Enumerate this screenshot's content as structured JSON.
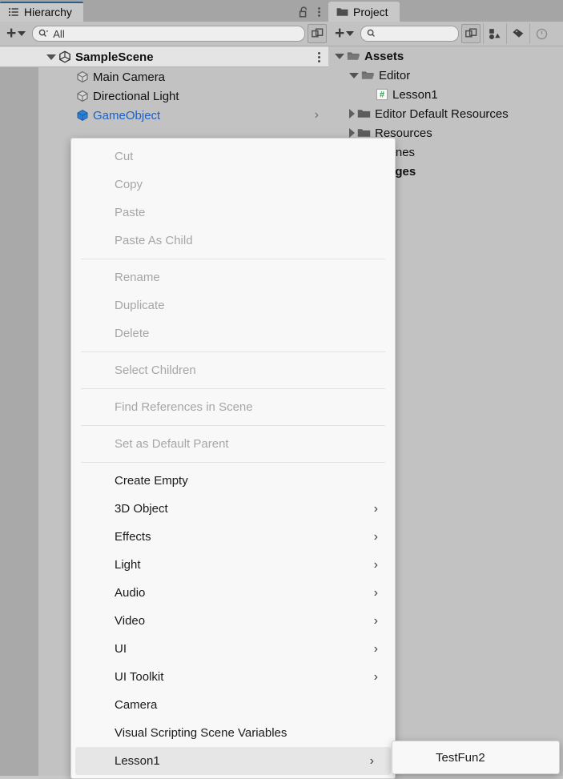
{
  "hierarchy": {
    "tab": {
      "label": "Hierarchy",
      "icon": "hierarchy-list-icon",
      "active": true
    },
    "header_icons": [
      {
        "name": "lock-open-icon"
      },
      {
        "name": "kebab-menu-icon"
      }
    ],
    "toolbar": {
      "add_label": "+",
      "add_dropdown_icon": "chevron-down-icon",
      "search": {
        "value": "All",
        "placeholder": "All",
        "icon": "search-icon"
      },
      "popout_icon": "popout-window-icon"
    },
    "tree": [
      {
        "label": "SampleScene",
        "icon": "unity-scene-icon",
        "depth": 0,
        "expanded": true,
        "bold": true,
        "kebab": true
      },
      {
        "label": "Main Camera",
        "icon": "gameobject-cube-icon",
        "depth": 1,
        "expanded": null,
        "bold": false
      },
      {
        "label": "Directional Light",
        "icon": "gameobject-cube-icon",
        "depth": 1,
        "expanded": null,
        "bold": false
      },
      {
        "label": "GameObject",
        "icon": "prefab-cube-icon",
        "depth": 1,
        "expanded": null,
        "bold": false,
        "prefab": true,
        "chevron": "›"
      }
    ]
  },
  "project": {
    "tab": {
      "label": "Project",
      "icon": "folder-icon",
      "active": false
    },
    "toolbar": {
      "add_label": "+",
      "add_dropdown_icon": "chevron-down-icon",
      "search": {
        "value": "",
        "placeholder": "",
        "icon": "search-icon"
      },
      "popout_icon": "popout-window-icon",
      "buttons": [
        {
          "name": "filter-by-type-icon"
        },
        {
          "name": "filter-by-label-icon"
        },
        {
          "name": "history-icon"
        }
      ]
    },
    "tree": [
      {
        "label": "Assets",
        "icon": "folder-open-icon",
        "depth": 0,
        "expanded": true,
        "bold": true
      },
      {
        "label": "Editor",
        "icon": "folder-open-icon",
        "depth": 1,
        "expanded": true,
        "bold": false
      },
      {
        "label": "Lesson1",
        "icon": "csharp-script-icon",
        "depth": 2,
        "expanded": null,
        "bold": false
      },
      {
        "label": "Editor Default Resources",
        "icon": "folder-icon",
        "depth": 1,
        "expanded": false,
        "bold": false
      },
      {
        "label": "Resources",
        "icon": "folder-icon",
        "depth": 1,
        "expanded": false,
        "bold": false
      },
      {
        "label": "Scenes",
        "icon": "folder-icon",
        "depth": 1,
        "expanded": false,
        "bold": false
      },
      {
        "label": "Packages",
        "icon": "folder-icon",
        "depth": 0,
        "expanded": false,
        "bold": true
      }
    ]
  },
  "context_menu": {
    "items": [
      {
        "label": "Cut",
        "disabled": true,
        "submenu": false
      },
      {
        "label": "Copy",
        "disabled": true,
        "submenu": false
      },
      {
        "label": "Paste",
        "disabled": true,
        "submenu": false
      },
      {
        "label": "Paste As Child",
        "disabled": true,
        "submenu": false
      },
      {
        "separator": true
      },
      {
        "label": "Rename",
        "disabled": true,
        "submenu": false
      },
      {
        "label": "Duplicate",
        "disabled": true,
        "submenu": false
      },
      {
        "label": "Delete",
        "disabled": true,
        "submenu": false
      },
      {
        "separator": true
      },
      {
        "label": "Select Children",
        "disabled": true,
        "submenu": false
      },
      {
        "separator": true
      },
      {
        "label": "Find References in Scene",
        "disabled": true,
        "submenu": false
      },
      {
        "separator": true
      },
      {
        "label": "Set as Default Parent",
        "disabled": true,
        "submenu": false
      },
      {
        "separator": true
      },
      {
        "label": "Create Empty",
        "disabled": false,
        "submenu": false
      },
      {
        "label": "3D Object",
        "disabled": false,
        "submenu": true
      },
      {
        "label": "Effects",
        "disabled": false,
        "submenu": true
      },
      {
        "label": "Light",
        "disabled": false,
        "submenu": true
      },
      {
        "label": "Audio",
        "disabled": false,
        "submenu": true
      },
      {
        "label": "Video",
        "disabled": false,
        "submenu": true
      },
      {
        "label": "UI",
        "disabled": false,
        "submenu": true
      },
      {
        "label": "UI Toolkit",
        "disabled": false,
        "submenu": true
      },
      {
        "label": "Camera",
        "disabled": false,
        "submenu": false
      },
      {
        "label": "Visual Scripting Scene Variables",
        "disabled": false,
        "submenu": false
      },
      {
        "label": "Lesson1",
        "disabled": false,
        "submenu": true,
        "highlighted": true
      }
    ],
    "submenu_arrow": "›"
  },
  "submenu": {
    "items": [
      {
        "label": "TestFun2",
        "disabled": false,
        "submenu": false
      }
    ]
  }
}
